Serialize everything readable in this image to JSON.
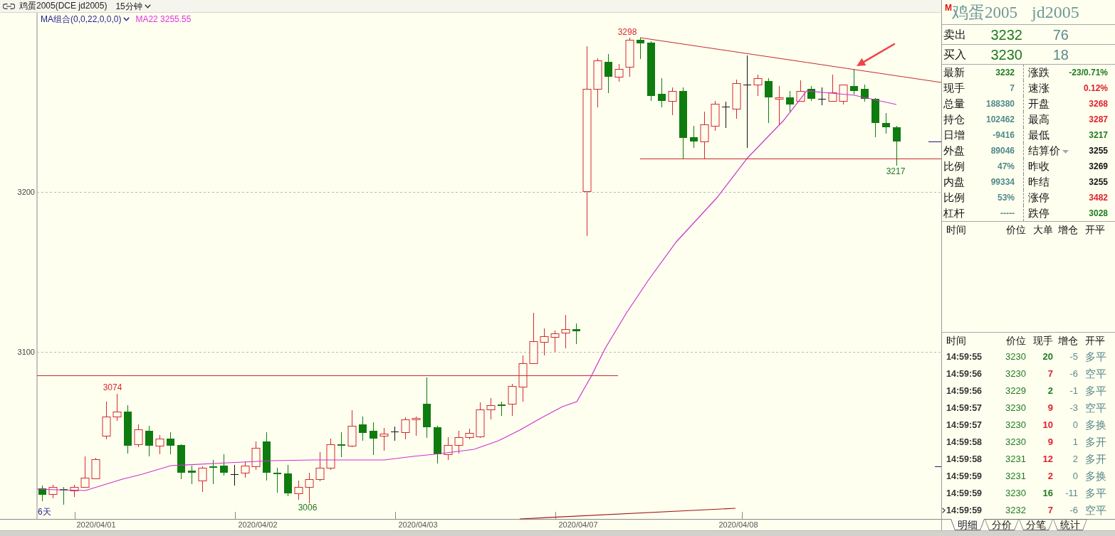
{
  "title_bar": {
    "symbol": "鸡蛋2005(DCE jd2005)",
    "period": "15分钟"
  },
  "chart": {
    "indicator": "MA组合(0,0,22,0,0,0)",
    "ma_reading": "MA22 3255.55",
    "y_axis_labels": [
      "3200",
      "3100"
    ],
    "x_axis_labels": [
      "2020/04/01",
      "2020/04/02",
      "2020/04/03",
      "2020/04/07",
      "2020/04/08"
    ],
    "price_marks": [
      {
        "text": "3298",
        "kind": "high"
      },
      {
        "text": "3074",
        "kind": "high"
      },
      {
        "text": "3006",
        "kind": "low"
      },
      {
        "text": "3217",
        "kind": "low"
      }
    ],
    "range_label": "6天"
  },
  "quote_panel": {
    "badge": "M",
    "name": "鸡蛋2005",
    "code": "jd2005",
    "quotes": [
      {
        "label": "卖出",
        "price": "3232",
        "volume": "76"
      },
      {
        "label": "买入",
        "price": "3230",
        "volume": "18"
      }
    ],
    "stats": [
      {
        "left": {
          "label": "最新",
          "value": "3232",
          "color": "#1e7a1e",
          "dropdown": false
        },
        "right": {
          "label": "涨跌",
          "value": "-23/0.71%",
          "color": "#1e7a1e",
          "dropdown": false
        }
      },
      {
        "left": {
          "label": "现手",
          "value": "7",
          "color": "#4f8a8a",
          "dropdown": false
        },
        "right": {
          "label": "速涨",
          "value": "0.12%",
          "color": "#e0202a",
          "dropdown": false
        }
      },
      {
        "left": {
          "label": "总量",
          "value": "188380",
          "color": "#4f8a8a",
          "dropdown": false
        },
        "right": {
          "label": "开盘",
          "value": "3268",
          "color": "#e0202a",
          "dropdown": false
        }
      },
      {
        "left": {
          "label": "持仓",
          "value": "102462",
          "color": "#4f8a8a",
          "dropdown": false
        },
        "right": {
          "label": "最高",
          "value": "3287",
          "color": "#e0202a",
          "dropdown": false
        }
      },
      {
        "left": {
          "label": "日增",
          "value": "-9416",
          "color": "#4f8a8a",
          "dropdown": false
        },
        "right": {
          "label": "最低",
          "value": "3217",
          "color": "#1e7a1e",
          "dropdown": false
        }
      },
      {
        "left": {
          "label": "外盘",
          "value": "89046",
          "color": "#4f8a8a",
          "dropdown": false
        },
        "right": {
          "label": "结算价",
          "value": "3255",
          "color": "#111111",
          "dropdown": true
        }
      },
      {
        "left": {
          "label": "比例",
          "value": "47%",
          "color": "#4f8a8a",
          "dropdown": false
        },
        "right": {
          "label": "昨收",
          "value": "3269",
          "color": "#111111",
          "dropdown": false
        }
      },
      {
        "left": {
          "label": "内盘",
          "value": "99334",
          "color": "#4f8a8a",
          "dropdown": false
        },
        "right": {
          "label": "昨结",
          "value": "3255",
          "color": "#111111",
          "dropdown": false
        }
      },
      {
        "left": {
          "label": "比例",
          "value": "53%",
          "color": "#4f8a8a",
          "dropdown": false
        },
        "right": {
          "label": "涨停",
          "value": "3482",
          "color": "#e0202a",
          "dropdown": false
        }
      },
      {
        "left": {
          "label": "杠杆",
          "value": "-----",
          "color": "#4f8a8a",
          "dropdown": false
        },
        "right": {
          "label": "跌停",
          "value": "3028",
          "color": "#1e7a1e",
          "dropdown": false
        }
      }
    ],
    "big_order_columns": [
      "时间",
      "价位",
      "大单",
      "增仓",
      "开平"
    ]
  },
  "trades": {
    "columns": [
      "时间",
      "价位",
      "现手",
      "增仓",
      "开平"
    ],
    "rows": [
      {
        "time": "14:59:55",
        "price": "3230",
        "volume": {
          "text": "20",
          "color": "#1e7a1e"
        },
        "oi_change": "-5",
        "open_close": "多平",
        "selected": false
      },
      {
        "time": "14:59:56",
        "price": "3230",
        "volume": {
          "text": "7",
          "color": "#e0202a"
        },
        "oi_change": "-6",
        "open_close": "空平",
        "selected": false
      },
      {
        "time": "14:59:56",
        "price": "3229",
        "volume": {
          "text": "2",
          "color": "#1e7a1e"
        },
        "oi_change": "-1",
        "open_close": "多平",
        "selected": false
      },
      {
        "time": "14:59:57",
        "price": "3230",
        "volume": {
          "text": "9",
          "color": "#e0202a"
        },
        "oi_change": "-3",
        "open_close": "空平",
        "selected": false
      },
      {
        "time": "14:59:57",
        "price": "3230",
        "volume": {
          "text": "10",
          "color": "#e0202a"
        },
        "oi_change": "0",
        "open_close": "多换",
        "selected": false
      },
      {
        "time": "14:59:58",
        "price": "3230",
        "volume": {
          "text": "9",
          "color": "#e0202a"
        },
        "oi_change": "1",
        "open_close": "多开",
        "selected": false
      },
      {
        "time": "14:59:58",
        "price": "3231",
        "volume": {
          "text": "12",
          "color": "#e0202a"
        },
        "oi_change": "2",
        "open_close": "多开",
        "selected": false
      },
      {
        "time": "14:59:59",
        "price": "3231",
        "volume": {
          "text": "2",
          "color": "#e0202a"
        },
        "oi_change": "0",
        "open_close": "多换",
        "selected": false
      },
      {
        "time": "14:59:59",
        "price": "3230",
        "volume": {
          "text": "16",
          "color": "#1e7a1e"
        },
        "oi_change": "-11",
        "open_close": "多平",
        "selected": false
      },
      {
        "time": "14:59:59",
        "price": "3232",
        "volume": {
          "text": "7",
          "color": "#e0202a"
        },
        "oi_change": "-6",
        "open_close": "空平",
        "selected": true
      }
    ]
  },
  "tabs": [
    {
      "label": "明细",
      "selected": true
    },
    {
      "label": "分价",
      "selected": false
    },
    {
      "label": "分笔",
      "selected": false
    },
    {
      "label": "统计",
      "selected": false
    }
  ]
}
